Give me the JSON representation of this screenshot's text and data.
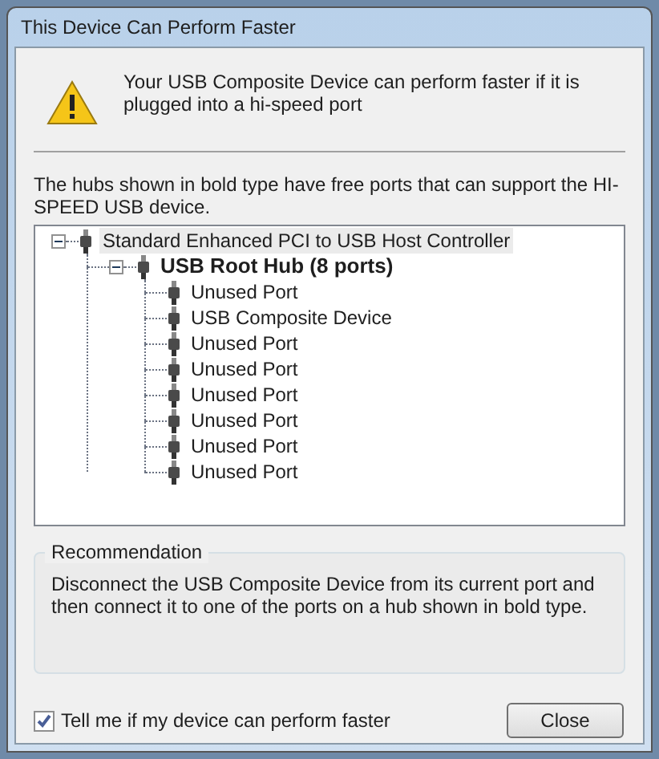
{
  "window": {
    "title": "This Device Can Perform Faster"
  },
  "message": "Your USB Composite Device can perform faster if it is plugged into a hi-speed port",
  "hint": "The hubs shown in bold type have free ports that can support the HI-SPEED USB device.",
  "tree": [
    {
      "label": "Standard Enhanced PCI to USB Host Controller",
      "bold": false,
      "selected": true,
      "expanded": true,
      "children": [
        {
          "label": "USB Root Hub (8 ports)",
          "bold": true,
          "selected": false,
          "expanded": true,
          "children": [
            {
              "label": "Unused Port",
              "bold": false,
              "selected": false
            },
            {
              "label": "USB Composite Device",
              "bold": false,
              "selected": false
            },
            {
              "label": "Unused Port",
              "bold": false,
              "selected": false
            },
            {
              "label": "Unused Port",
              "bold": false,
              "selected": false
            },
            {
              "label": "Unused Port",
              "bold": false,
              "selected": false
            },
            {
              "label": "Unused Port",
              "bold": false,
              "selected": false
            },
            {
              "label": "Unused Port",
              "bold": false,
              "selected": false
            },
            {
              "label": "Unused Port",
              "bold": false,
              "selected": false
            }
          ]
        }
      ]
    }
  ],
  "recommendation": {
    "title": "Recommendation",
    "text": "Disconnect the USB Composite Device from its current port and then connect it to one of the ports on a hub shown in bold type."
  },
  "checkbox": {
    "label": "Tell me if my device can perform faster",
    "checked": true
  },
  "buttons": [
    "Close"
  ]
}
